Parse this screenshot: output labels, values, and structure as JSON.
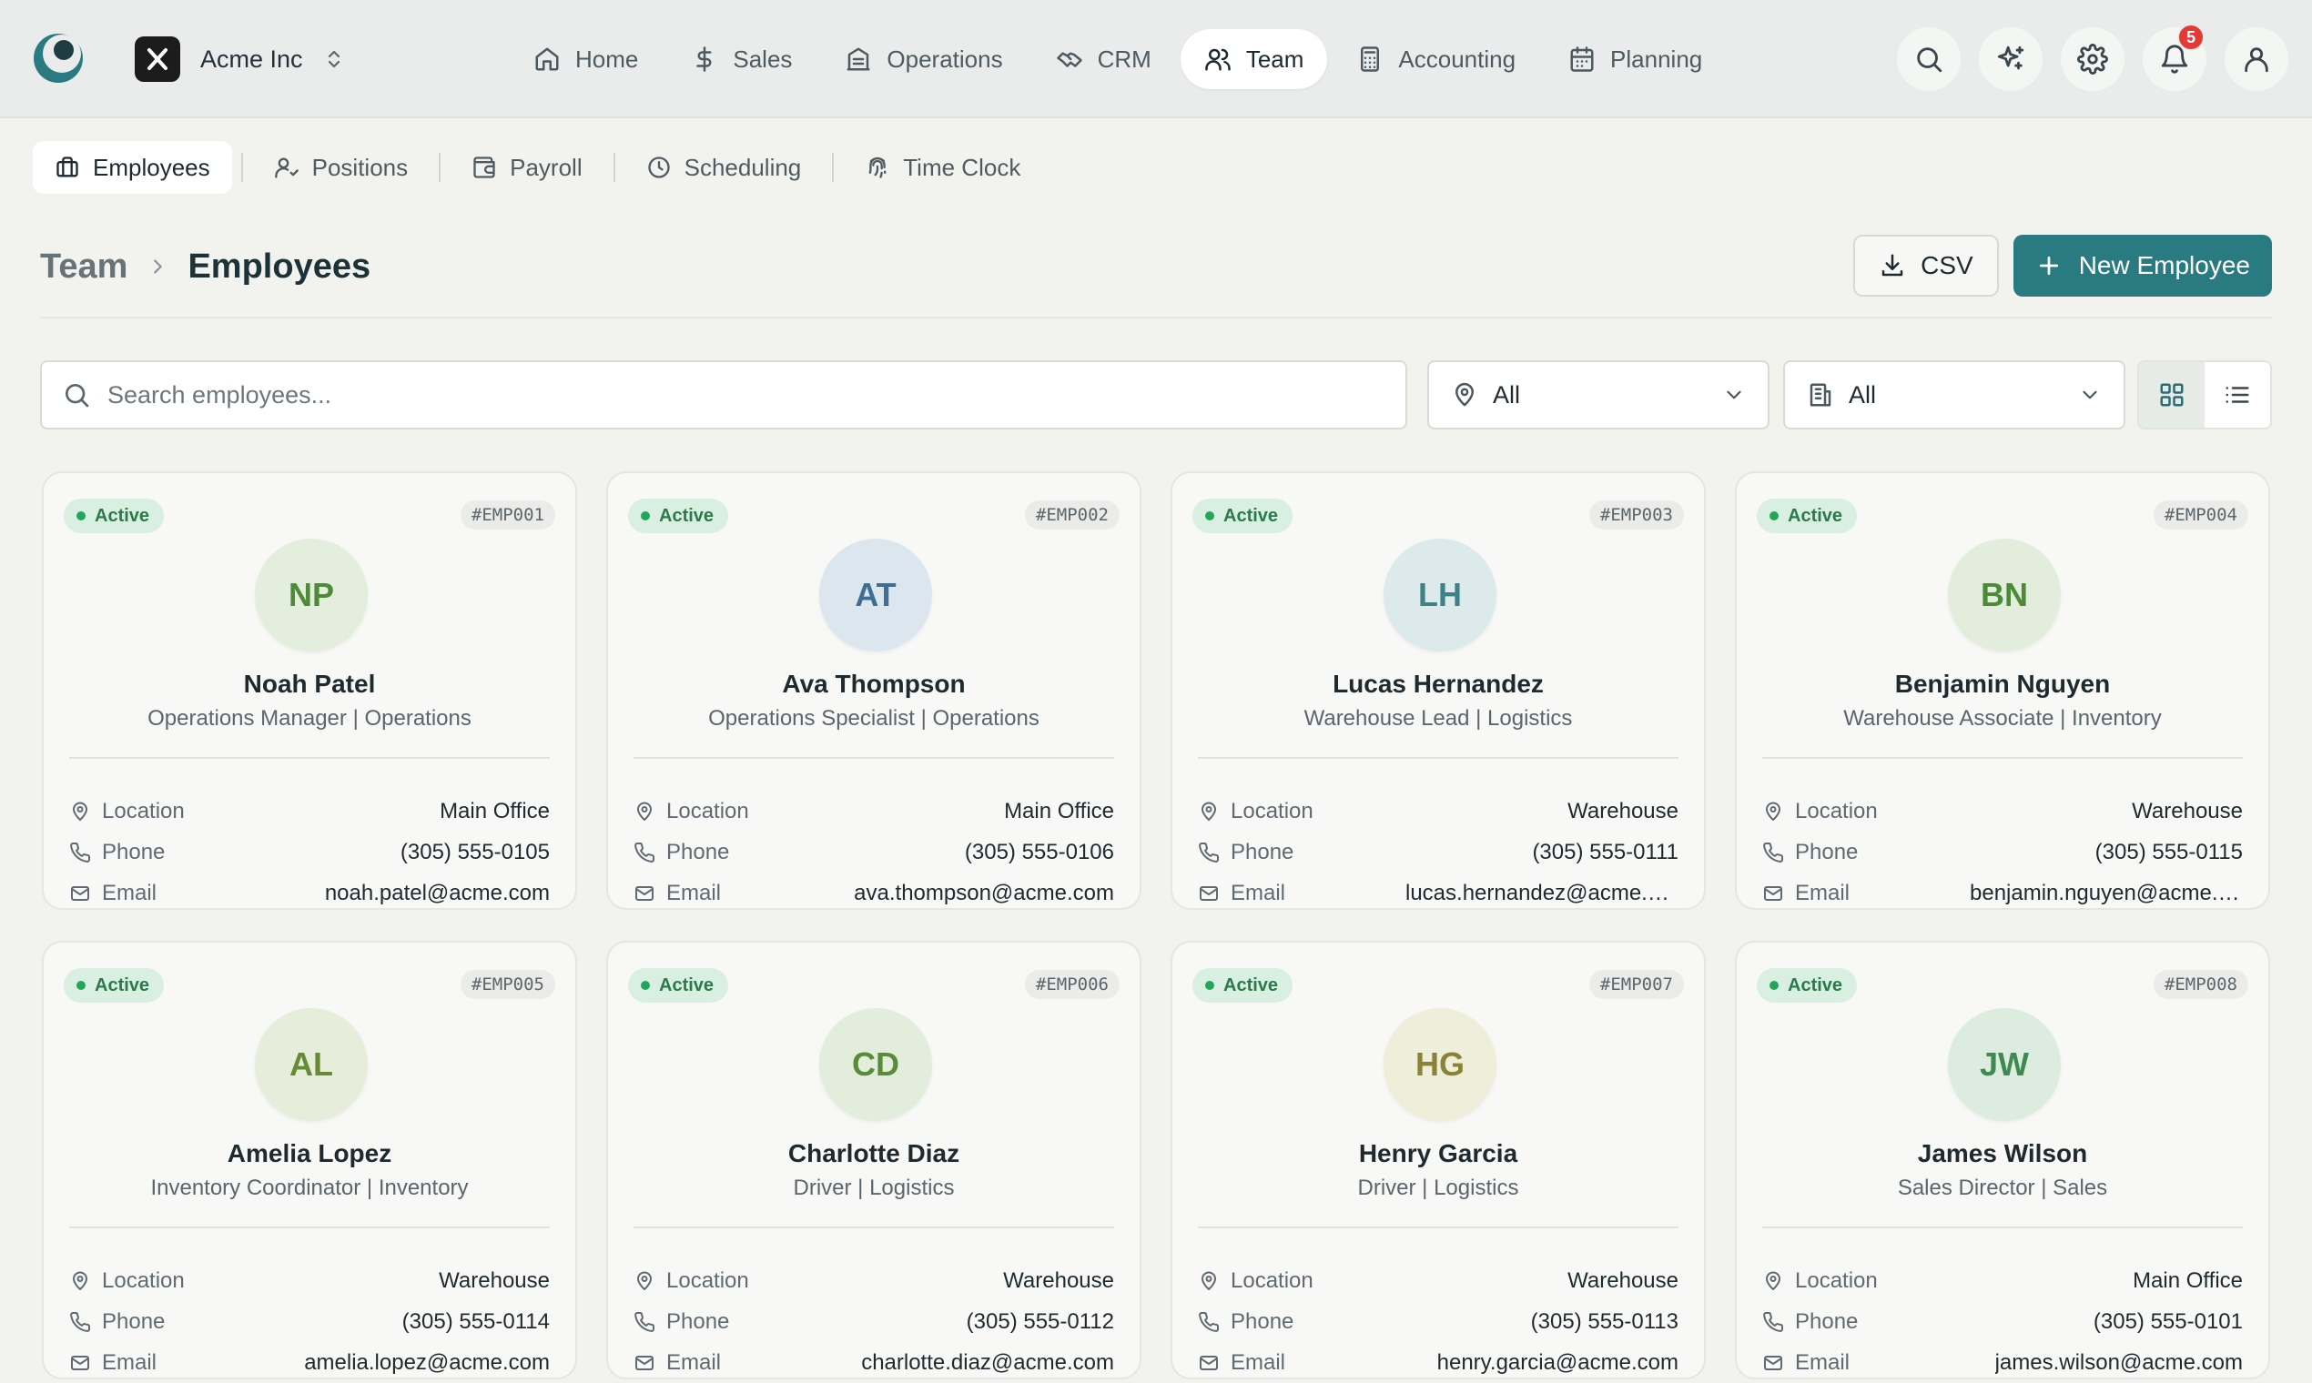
{
  "app": {
    "company": "Acme Inc"
  },
  "nav": {
    "items": [
      {
        "label": "Home",
        "icon": "home-icon"
      },
      {
        "label": "Sales",
        "icon": "dollar-icon"
      },
      {
        "label": "Operations",
        "icon": "building-icon"
      },
      {
        "label": "CRM",
        "icon": "handshake-icon"
      },
      {
        "label": "Team",
        "icon": "users-icon",
        "active": true
      },
      {
        "label": "Accounting",
        "icon": "calculator-icon"
      },
      {
        "label": "Planning",
        "icon": "calendar-icon"
      }
    ],
    "notifications_count": "5"
  },
  "subnav": {
    "items": [
      {
        "label": "Employees",
        "icon": "briefcase-icon",
        "active": true
      },
      {
        "label": "Positions",
        "icon": "user-check-icon"
      },
      {
        "label": "Payroll",
        "icon": "wallet-icon"
      },
      {
        "label": "Scheduling",
        "icon": "clock-icon"
      },
      {
        "label": "Time Clock",
        "icon": "fingerprint-icon"
      }
    ]
  },
  "header": {
    "breadcrumb_parent": "Team",
    "breadcrumb_current": "Employees",
    "csv_label": "CSV",
    "new_label": "New Employee"
  },
  "filters": {
    "search_placeholder": "Search employees...",
    "search_value": "",
    "location_value": "All",
    "department_value": "All"
  },
  "labels": {
    "location": "Location",
    "phone": "Phone",
    "email": "Email"
  },
  "employees": [
    {
      "status": "Active",
      "id": "#EMP001",
      "initials": "NP",
      "name": "Noah Patel",
      "role": "Operations Manager | Operations",
      "location": "Main Office",
      "phone": "(305) 555-0105",
      "email": "noah.patel@acme.com",
      "avatar_bg": "#e4eedc",
      "avatar_fg": "#4f8a3a"
    },
    {
      "status": "Active",
      "id": "#EMP002",
      "initials": "AT",
      "name": "Ava Thompson",
      "role": "Operations Specialist | Operations",
      "location": "Main Office",
      "phone": "(305) 555-0106",
      "email": "ava.thompson@acme.com",
      "avatar_bg": "#dce6ef",
      "avatar_fg": "#3f6d95"
    },
    {
      "status": "Active",
      "id": "#EMP003",
      "initials": "LH",
      "name": "Lucas Hernandez",
      "role": "Warehouse Lead | Logistics",
      "location": "Warehouse",
      "phone": "(305) 555-0111",
      "email": "lucas.hernandez@acme.com",
      "avatar_bg": "#dceaec",
      "avatar_fg": "#3e8288"
    },
    {
      "status": "Active",
      "id": "#EMP004",
      "initials": "BN",
      "name": "Benjamin Nguyen",
      "role": "Warehouse Associate | Inventory",
      "location": "Warehouse",
      "phone": "(305) 555-0115",
      "email": "benjamin.nguyen@acme.com",
      "avatar_bg": "#e2eedb",
      "avatar_fg": "#4c8a38"
    },
    {
      "status": "Active",
      "id": "#EMP005",
      "initials": "AL",
      "name": "Amelia Lopez",
      "role": "Inventory Coordinator | Inventory",
      "location": "Warehouse",
      "phone": "(305) 555-0114",
      "email": "amelia.lopez@acme.com",
      "avatar_bg": "#e6eedb",
      "avatar_fg": "#678a35"
    },
    {
      "status": "Active",
      "id": "#EMP006",
      "initials": "CD",
      "name": "Charlotte Diaz",
      "role": "Driver | Logistics",
      "location": "Warehouse",
      "phone": "(305) 555-0112",
      "email": "charlotte.diaz@acme.com",
      "avatar_bg": "#e2eedb",
      "avatar_fg": "#5a8a3a"
    },
    {
      "status": "Active",
      "id": "#EMP007",
      "initials": "HG",
      "name": "Henry Garcia",
      "role": "Driver | Logistics",
      "location": "Warehouse",
      "phone": "(305) 555-0113",
      "email": "henry.garcia@acme.com",
      "avatar_bg": "#eeeedb",
      "avatar_fg": "#8a8235"
    },
    {
      "status": "Active",
      "id": "#EMP008",
      "initials": "JW",
      "name": "James Wilson",
      "role": "Sales Director | Sales",
      "location": "Main Office",
      "phone": "(305) 555-0101",
      "email": "james.wilson@acme.com",
      "avatar_bg": "#dcecdf",
      "avatar_fg": "#3f8a52"
    }
  ],
  "colors": {
    "primary": "#2a7a82",
    "active_badge": "#d8efe1",
    "notif": "#e53935"
  }
}
